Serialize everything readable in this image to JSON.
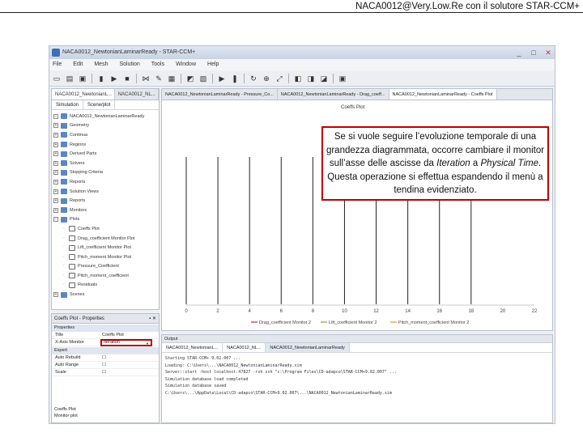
{
  "slide": {
    "header": "NACA0012@Very.Low.Re con il solutore STAR-CCM+",
    "callout": {
      "part1": "Se si vuole seguire l’evoluzione temporale di una grandezza diagrammata, occorre cambiare il monitor sull’asse delle ascisse da ",
      "em1": "Iteration",
      "part2": " a ",
      "em2": "Physical Time",
      "part3": ". Questa operazione si effettua espandendo il menù a tendina evidenziato."
    }
  },
  "app": {
    "title": "NACA0012_NewtonianLaminarReady - STAR-CCM+",
    "window_buttons": [
      "_",
      "□",
      "✕"
    ],
    "menu": [
      "File",
      "Edit",
      "Mesh",
      "Solution",
      "Tools",
      "Window",
      "Help"
    ],
    "toolbar_icons": [
      "new-icon",
      "open-icon",
      "save-icon",
      "sep",
      "step-icon",
      "run-icon",
      "stop-icon",
      "sep",
      "mesh-icon",
      "tool-icon",
      "grid-icon",
      "sep",
      "scene-icon",
      "plot-icon",
      "sep",
      "play-icon",
      "pause-icon",
      "sep",
      "rotate-icon",
      "zoom-icon",
      "fit-icon",
      "sep",
      "view-icon",
      "view2-icon",
      "view3-icon",
      "sep",
      "save-view-icon"
    ]
  },
  "left_panel": {
    "tabs": [
      "NACA0012_NewtonianL...",
      "NACA0012_NL..."
    ],
    "subtabs": [
      "Simulation",
      "Scene/plot"
    ],
    "tree": [
      {
        "label": "NACA0012_NewtonianLaminarReady",
        "level": 0,
        "icon": "folder"
      },
      {
        "label": "Geometry",
        "level": 1,
        "icon": "folder"
      },
      {
        "label": "Continua",
        "level": 1,
        "icon": "folder"
      },
      {
        "label": "Regions",
        "level": 1,
        "icon": "folder"
      },
      {
        "label": "Derived Parts",
        "level": 1,
        "icon": "folder"
      },
      {
        "label": "Solvers",
        "level": 1,
        "icon": "folder"
      },
      {
        "label": "Stopping Criteria",
        "level": 1,
        "icon": "folder"
      },
      {
        "label": "Reports",
        "level": 1,
        "icon": "folder"
      },
      {
        "label": "Solution Views",
        "level": 1,
        "icon": "folder"
      },
      {
        "label": "Reports",
        "level": 1,
        "icon": "folder"
      },
      {
        "label": "Monitors",
        "level": 1,
        "icon": "folder"
      },
      {
        "label": "Plots",
        "level": 1,
        "icon": "folder"
      },
      {
        "label": "Coeffs Plot",
        "level": 2,
        "icon": "plot"
      },
      {
        "label": "Drag_coefficient Monitor Plot",
        "level": 2,
        "icon": "plot"
      },
      {
        "label": "Lift_coefficient Monitor Plot",
        "level": 2,
        "icon": "plot"
      },
      {
        "label": "Pitch_moment Monitor Plot",
        "level": 2,
        "icon": "plot"
      },
      {
        "label": "Pressure_Coefficient",
        "level": 2,
        "icon": "plot"
      },
      {
        "label": "Pitch_moment_coefficient",
        "level": 2,
        "icon": "plot"
      },
      {
        "label": "Residuals",
        "level": 2,
        "icon": "plot"
      },
      {
        "label": "Scenes",
        "level": 1,
        "icon": "folder"
      }
    ]
  },
  "props_panel": {
    "title": "Coeffs Plot - Properties",
    "sections": [
      {
        "name": "Properties",
        "rows": [
          {
            "key": "Title",
            "value": "Coeffs Plot"
          },
          {
            "key": "X-Axis Monitor",
            "value": "Iteration",
            "highlighted": true
          }
        ]
      },
      {
        "name": "Expert",
        "rows": [
          {
            "key": "Auto Rebuild",
            "value": "☐"
          },
          {
            "key": "Auto Range",
            "value": "☐"
          },
          {
            "key": "Scale",
            "value": "☐"
          }
        ]
      }
    ],
    "footer": [
      "Coeffs Plot",
      "Monitor plot"
    ]
  },
  "doc_tabs": [
    "NACA0012_NewtonianLaminarReady - Pressure_Co...",
    "NACA0012_NewtonianLaminarReady - Drag_coeff...",
    "NACA0012_NewtonianLaminarReady - Coeffs Plot"
  ],
  "chart_data": {
    "type": "line",
    "title": "Coeffs Plot",
    "x_ticks": [
      0,
      2,
      4,
      6,
      8,
      10,
      12,
      14,
      16,
      18,
      20,
      22
    ],
    "xlim": [
      0,
      22
    ],
    "vertical_gridlines_at": [
      0,
      2,
      4,
      6,
      8,
      10,
      12,
      14,
      16,
      18
    ],
    "series": [
      {
        "name": "Drag_coefficient Monitor 2",
        "color": "#d9534f"
      },
      {
        "name": "Lift_coefficient Monitor 2",
        "color": "#8bc34a"
      },
      {
        "name": "Pitch_moment_coefficient Monitor 2",
        "color": "#f0ad4e"
      }
    ],
    "grid": true,
    "legend_position": "bottom"
  },
  "output_panel": {
    "title": "Output",
    "tabs": [
      "NACA0012_NewtonianL...",
      "NACA0012_NL..."
    ],
    "active_tab": "NACA0012_NewtonianLaminarReady",
    "lines": [
      "Starting STAR-CCM+ 9.02.007 ...",
      "Loading: C:\\Users\\...\\NACA0012_NewtonianLaminarReady.sim",
      "Server::start -host localhost:47827 -rsh ssh \"c:\\Program Files\\CD-adapco\\STAR-CCM+9.02.007\" ...",
      "Simulation database load completed",
      "Simulation database saved",
      "C:\\Users\\...\\AppData\\Local\\CD-adapco\\STAR-CCM+9.02.007\\...\\NACA0012_NewtonianLaminarReady.sim"
    ]
  }
}
